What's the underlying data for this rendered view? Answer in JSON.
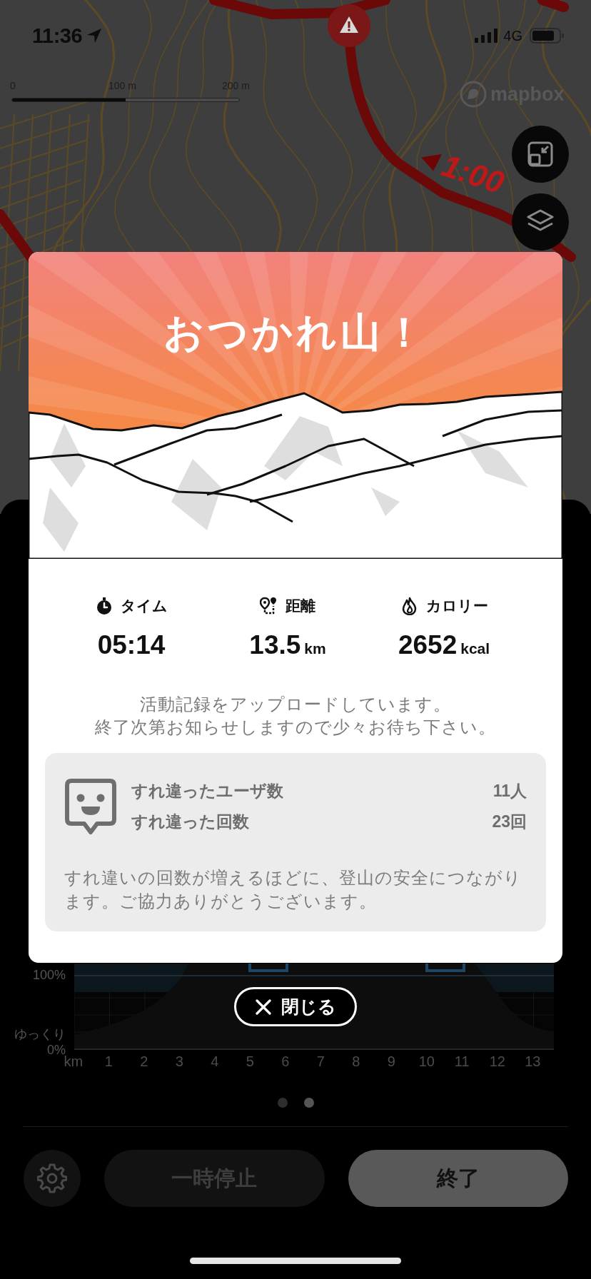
{
  "status_bar": {
    "time": "11:36",
    "network": "4G"
  },
  "map": {
    "scale_labels": [
      "0",
      "100 m",
      "200 m"
    ],
    "route_time_marker": "1:00",
    "attribution": "mapbox"
  },
  "activity_sheet": {
    "chart": {
      "y_labels": [
        "100%",
        "ゆっくり",
        "0%"
      ],
      "x_labels": [
        "km",
        "1",
        "2",
        "3",
        "4",
        "5",
        "6",
        "7",
        "8",
        "9",
        "10",
        "11",
        "12",
        "13"
      ]
    },
    "pager": [
      {
        "selected": false
      },
      {
        "selected": true
      }
    ],
    "pause_button": {
      "label": "一時停止",
      "disabled": true
    },
    "finish_button": {
      "label": "終了"
    }
  },
  "completion_dialog": {
    "title": "おつかれ山！",
    "stats": [
      {
        "kind": "time",
        "label": "タイム",
        "value": "05:14"
      },
      {
        "kind": "distance",
        "label": "距離",
        "value": "13.5",
        "unit": "km"
      },
      {
        "kind": "calories",
        "label": "カロリー",
        "value": "2652",
        "unit": "kcal"
      }
    ],
    "message_lines": [
      "活動記録をアップロードしています。",
      "終了次第お知らせしますので少々お待ち下さい。"
    ],
    "encounters": {
      "rows": [
        {
          "label": "すれ違ったユーザ数",
          "value": "11人"
        },
        {
          "label": "すれ違った回数",
          "value": "23回"
        }
      ],
      "note": "すれ違いの回数が増えるほどに、登山の安全につながります。ご協力ありがとうございます。"
    },
    "close_button": "閉じる"
  }
}
